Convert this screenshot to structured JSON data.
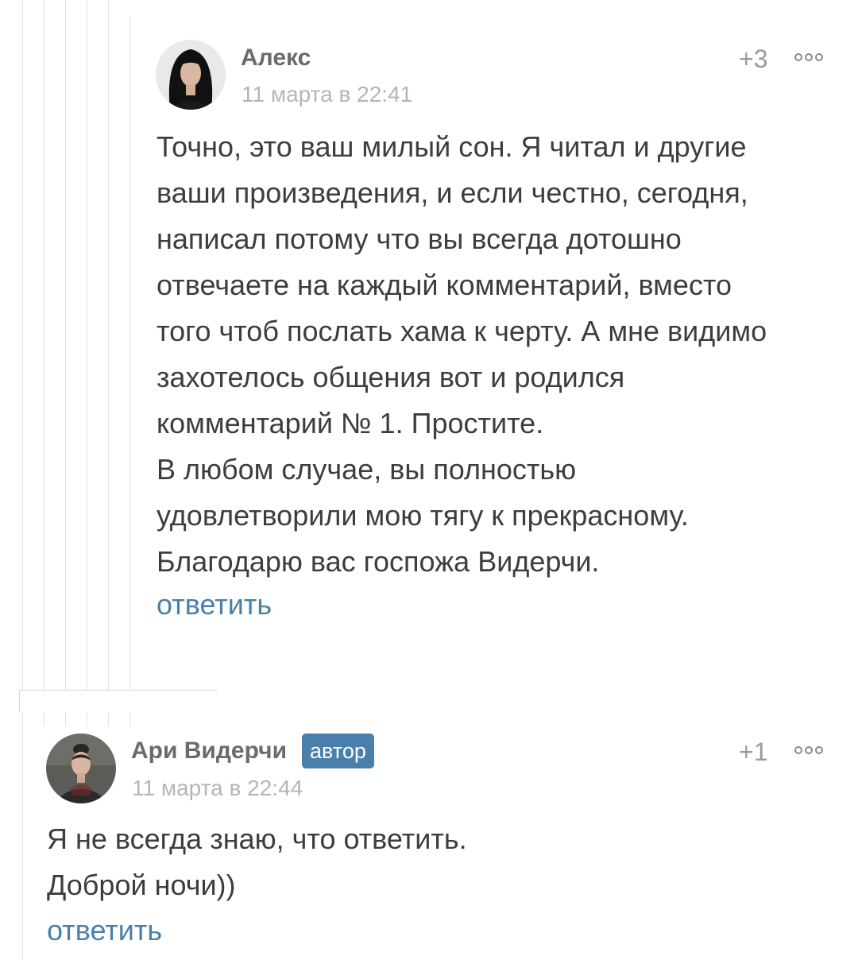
{
  "comments": [
    {
      "author": "Алекс",
      "badge": "",
      "date": "11 марта в 22:41",
      "rating": "+3",
      "avatar_icon": "avatar-woman-dark-hair",
      "more_icon": "more-dots-icon",
      "lines": [
        "Точно, это ваш милый сон. Я читал и другие",
        "ваши произведения, и если честно, сегодня,",
        "написал потому что вы всегда дотошно",
        "отвечаете на каждый комментарий, вместо",
        "того чтоб послать хама к черту. А мне видимо",
        "захотелось общения вот и родился",
        "комментарий № 1. Простите.",
        "В любом случае, вы полностью",
        "удовлетворили мою тягу к прекрасному.",
        "Благодарю вас госпожа Видерчи."
      ],
      "reply": "ответить"
    },
    {
      "author": "Ари Видерчи",
      "badge": "автор",
      "date": "11 марта в 22:44",
      "rating": "+1",
      "avatar_icon": "avatar-woman-portrait",
      "more_icon": "more-dots-icon",
      "lines": [
        "Я не всегда знаю, что ответить.",
        "Доброй ночи))"
      ],
      "reply": "ответить"
    }
  ],
  "colors": {
    "accent": "#4a7fab",
    "text": "#3d3d3d",
    "meta": "#b5b5b5",
    "thread_line": "#e3e3e3"
  }
}
